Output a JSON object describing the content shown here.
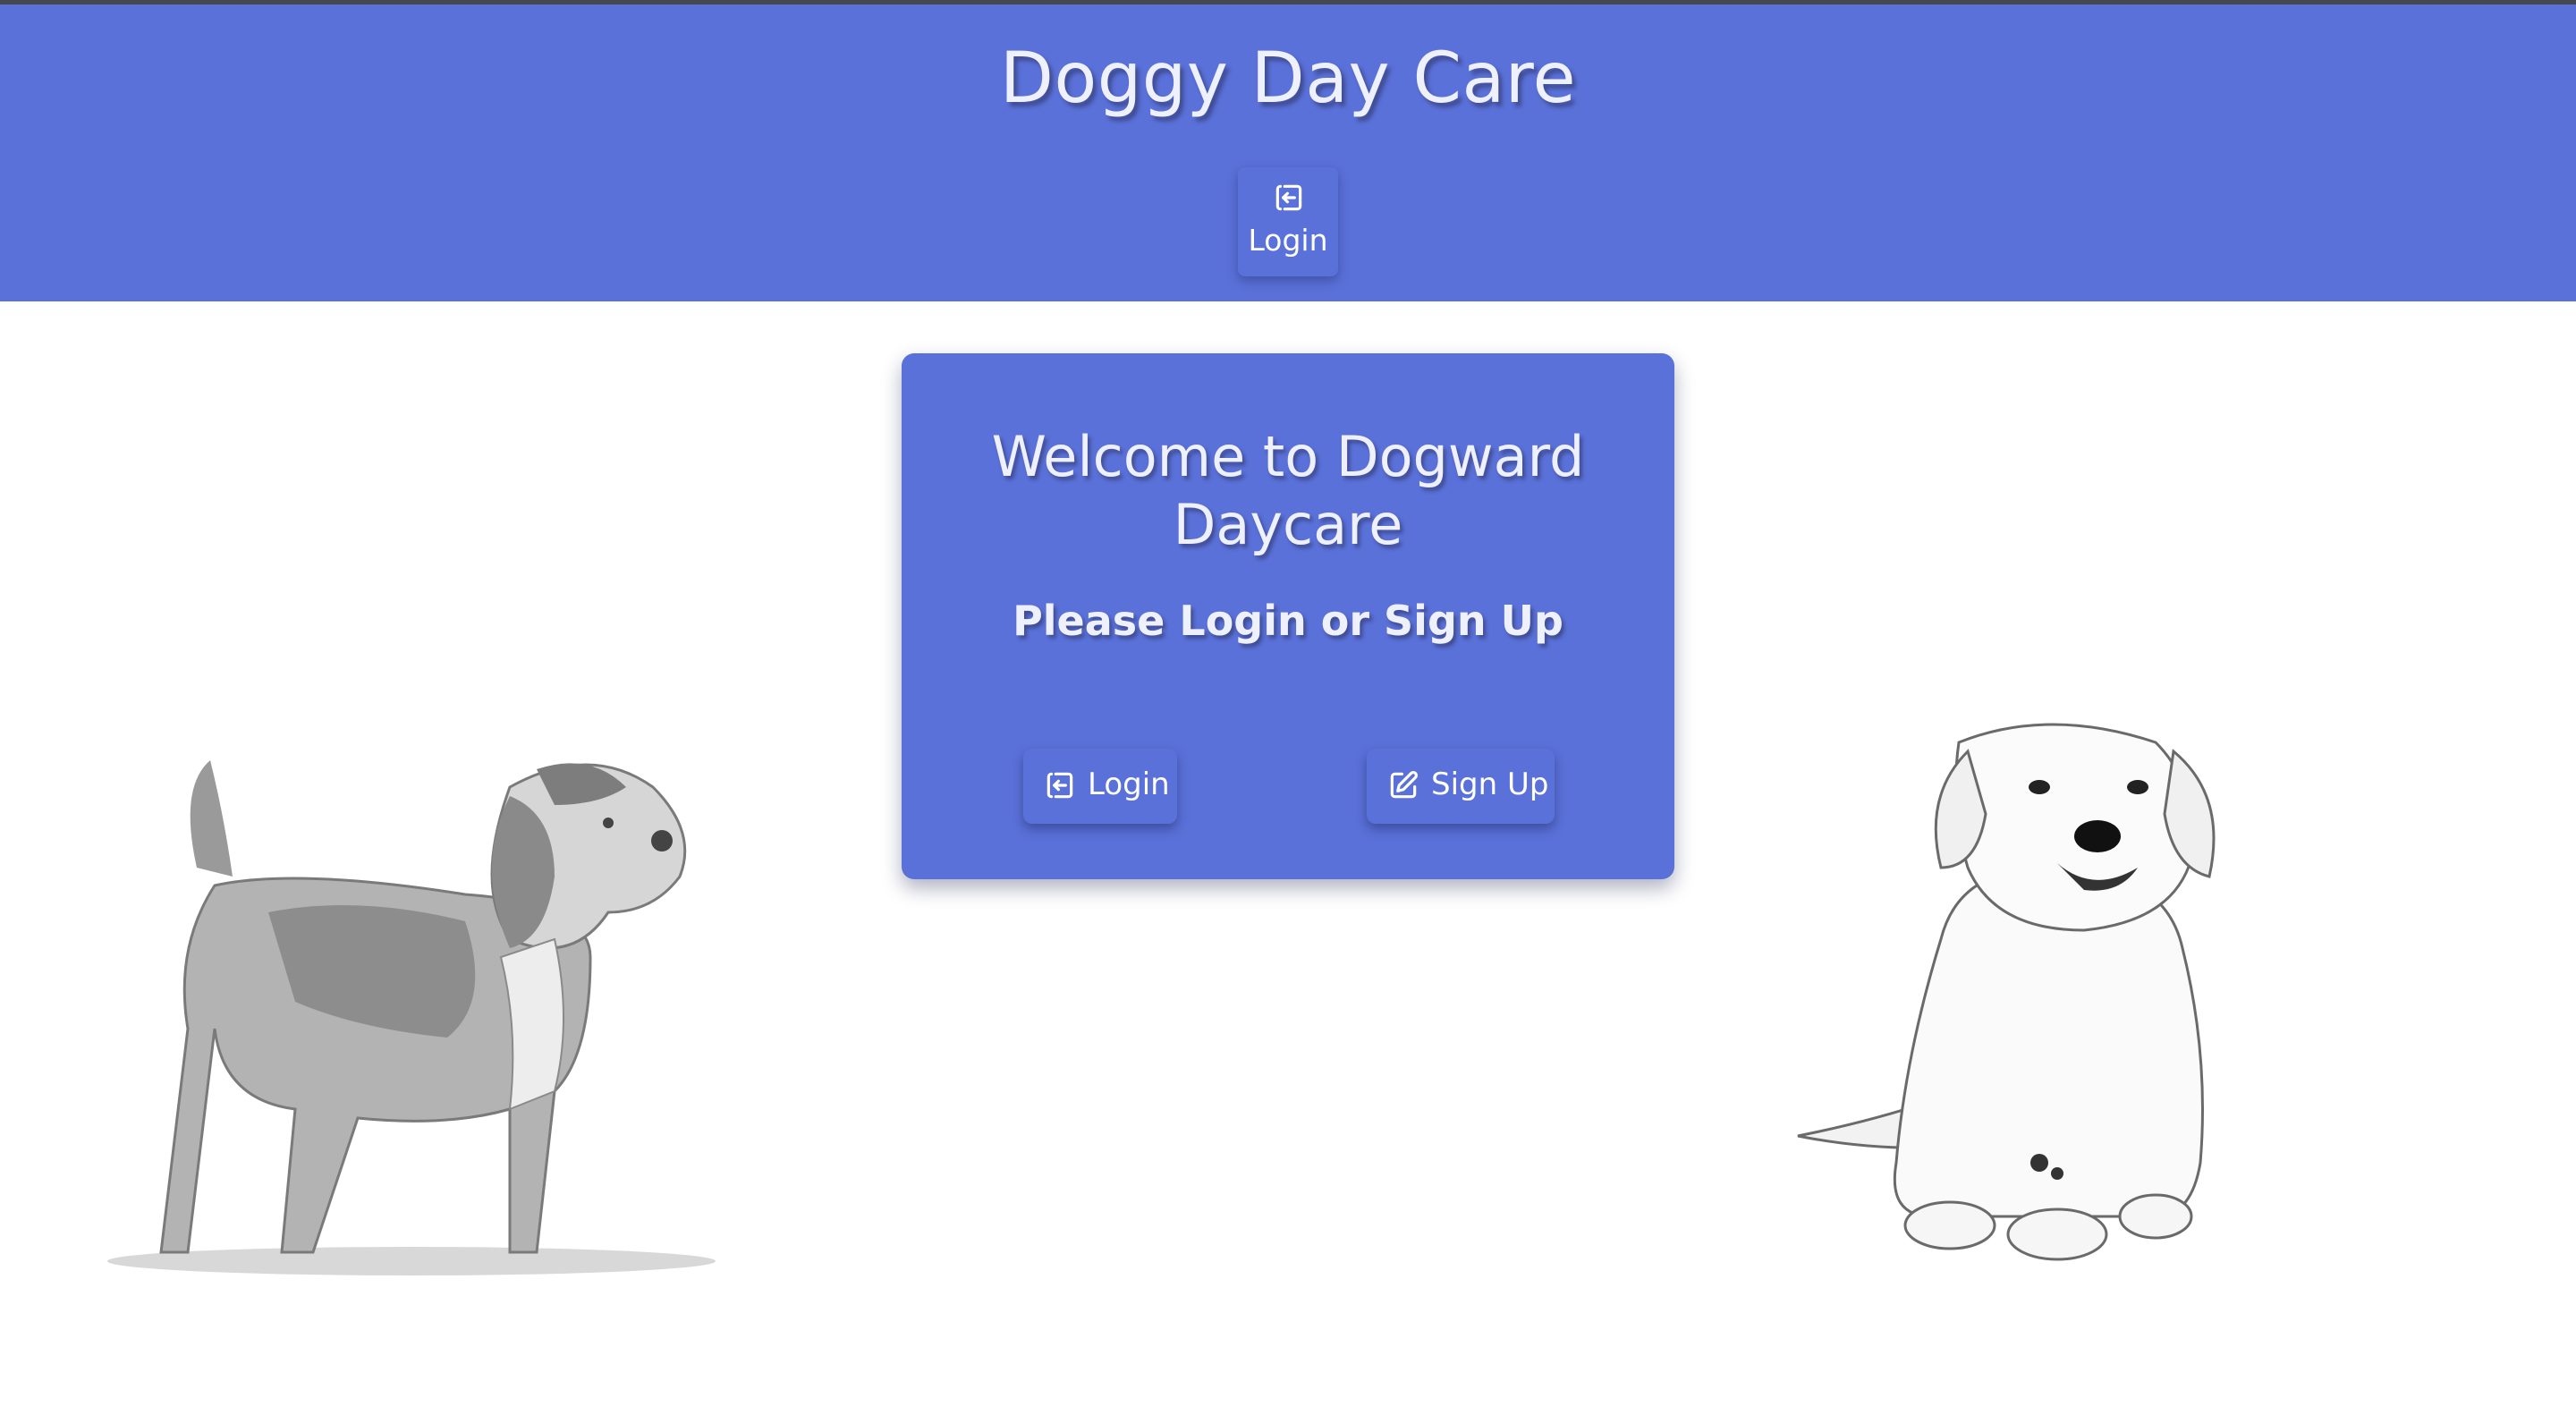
{
  "header": {
    "title": "Doggy Day Care",
    "login_label": "Login",
    "login_icon": "login-icon"
  },
  "card": {
    "heading": "Welcome to Dogward Daycare",
    "subheading": "Please Login or Sign Up",
    "login_label": "Login",
    "login_icon": "login-icon",
    "signup_label": "Sign Up",
    "signup_icon": "edit-icon"
  },
  "colors": {
    "brand": "#5a71d9",
    "text_light": "#eef0fb",
    "background": "#ffffff"
  }
}
